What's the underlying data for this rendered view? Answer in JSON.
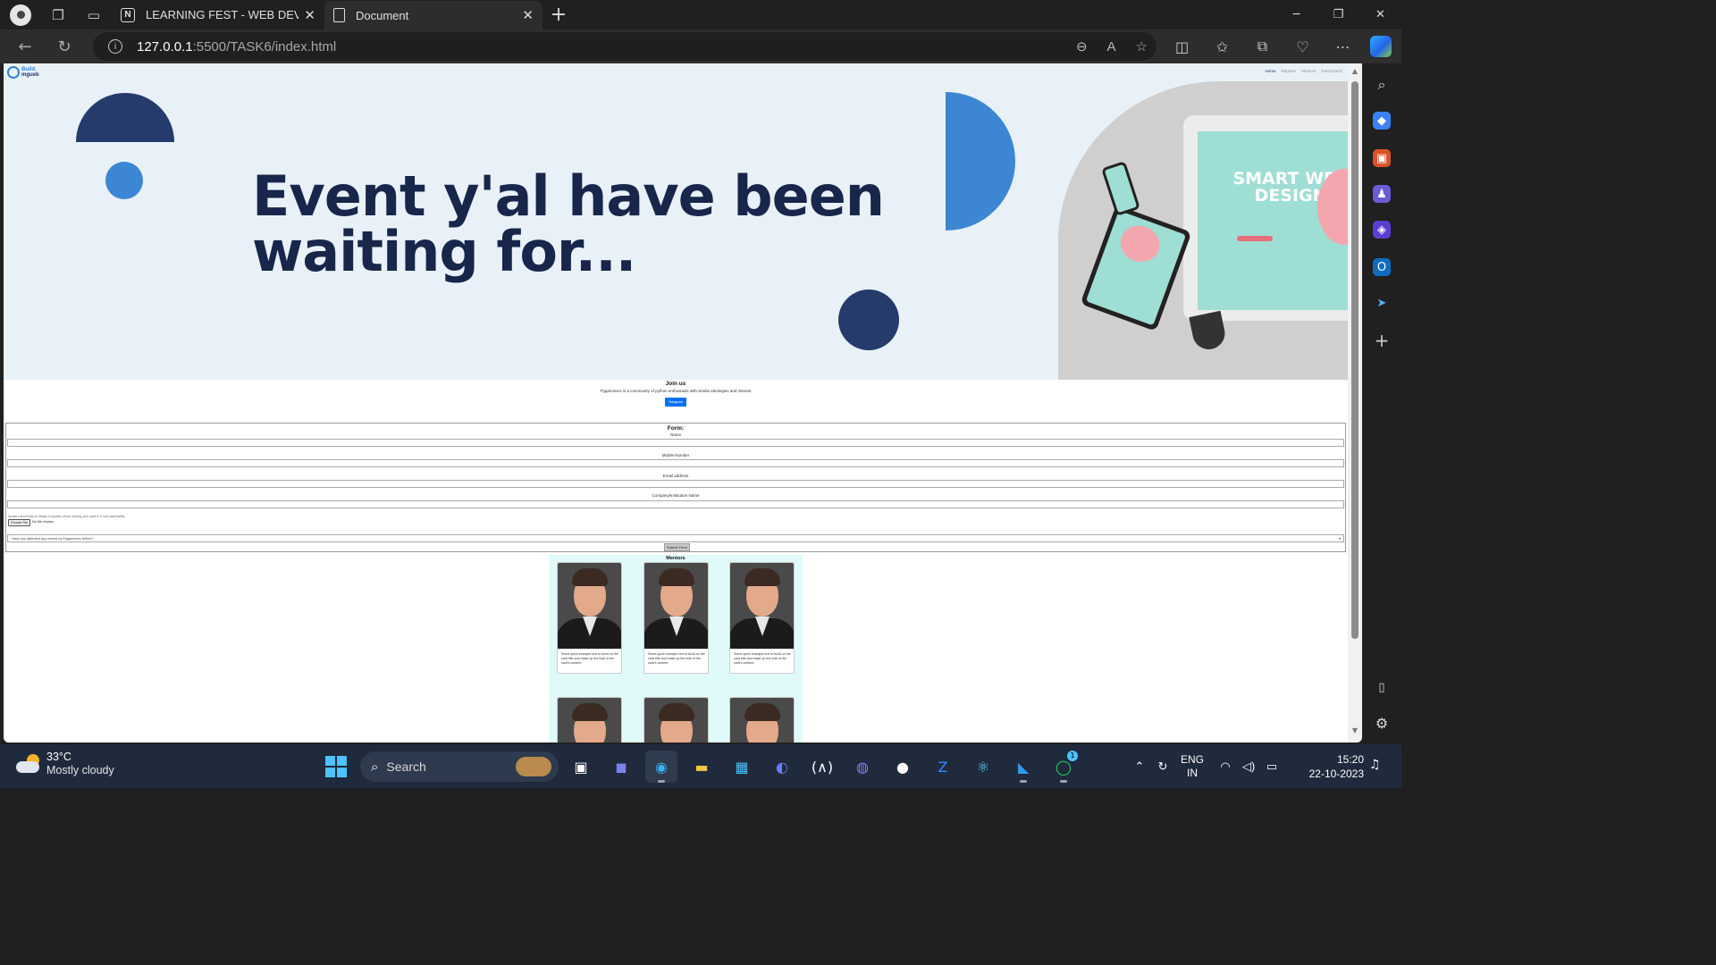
{
  "browser": {
    "tabs": [
      {
        "label": "LEARNING FEST - WEB DEVELOPI",
        "favicon": "notion-icon",
        "active": false
      },
      {
        "label": "Document",
        "favicon": "document-icon",
        "active": true
      }
    ],
    "url_host": "127.0.0.1",
    "url_path": ":5500/TASK6/index.html"
  },
  "site": {
    "logo_text_1": "Build.",
    "logo_text_2": "mgueb",
    "nav": [
      "Home",
      "Register",
      "Mentors",
      "Participants"
    ]
  },
  "hero": {
    "title": "Event y'al have been waiting for...",
    "image_text": "SMART WEB DESIGN"
  },
  "join": {
    "title": "Join us",
    "description": "Pygammers is a community of python enthusiasts with similar ideologies and interest",
    "button": "Telegram"
  },
  "form": {
    "title": "Form:",
    "fields": [
      {
        "label": "Name"
      },
      {
        "label": "Mobile Number"
      },
      {
        "label": "Email address"
      },
      {
        "label": "Company/Institution Name"
      }
    ],
    "upload_note": "Upload a short entry on design of a python whose working, your name in it, your style/quality",
    "file_button": "Choose File",
    "file_status": "No file chosen",
    "select_placeholder": "Have you attended any events by Pygammers before?",
    "submit": "Submit Form"
  },
  "mentors": {
    "title": "Mentors",
    "cards": [
      {
        "text": "Some quick example text to build on the card title and make up the bulk of the card's content."
      },
      {
        "text": "Some quick example text to build on the card title and make up the bulk of the card's content."
      },
      {
        "text": "Some quick example text to build on the card title and make up the bulk of the card's content."
      },
      {
        "text": ""
      },
      {
        "text": ""
      },
      {
        "text": ""
      }
    ]
  },
  "taskbar": {
    "weather_temp": "33°C",
    "weather_desc": "Mostly cloudy",
    "search_label": "Search",
    "lang_1": "ENG",
    "lang_2": "IN",
    "time": "15:20",
    "date": "22-10-2023",
    "whatsapp_badge": "1"
  },
  "colors": {
    "hero_bg": "#e9f1f8",
    "navy": "#253b6b",
    "blue": "#3d86d3",
    "mentors_bg": "#e0fafa",
    "telegram_btn": "#0d6efd"
  }
}
